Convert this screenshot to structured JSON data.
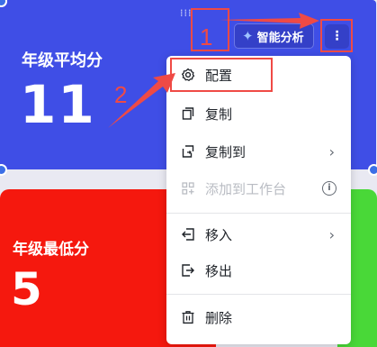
{
  "cards": {
    "grade_average": {
      "title": "年级平均分",
      "value": "11"
    },
    "grade_lowest": {
      "title": "年级最低分",
      "value": "5"
    }
  },
  "toolbar": {
    "ai_label": "智能分析",
    "more_label": "⋮"
  },
  "menu": {
    "items": [
      {
        "label": "配置",
        "icon": "gear-icon"
      },
      {
        "label": "复制",
        "icon": "copy-icon"
      },
      {
        "label": "复制到",
        "icon": "copy-to-icon",
        "submenu": true
      },
      {
        "label": "添加到工作台",
        "icon": "grid-add-icon",
        "disabled": true,
        "info": true
      },
      {
        "label": "移入",
        "icon": "move-in-icon",
        "submenu": true
      },
      {
        "label": "移出",
        "icon": "move-out-icon"
      },
      {
        "label": "删除",
        "icon": "trash-icon"
      }
    ]
  },
  "annotations": {
    "step1": "1",
    "step2": "2"
  },
  "colors": {
    "card_blue": "#3f4ee6",
    "card_red": "#f5180e",
    "card_green": "#49d838",
    "annotation": "#ef4a45"
  }
}
